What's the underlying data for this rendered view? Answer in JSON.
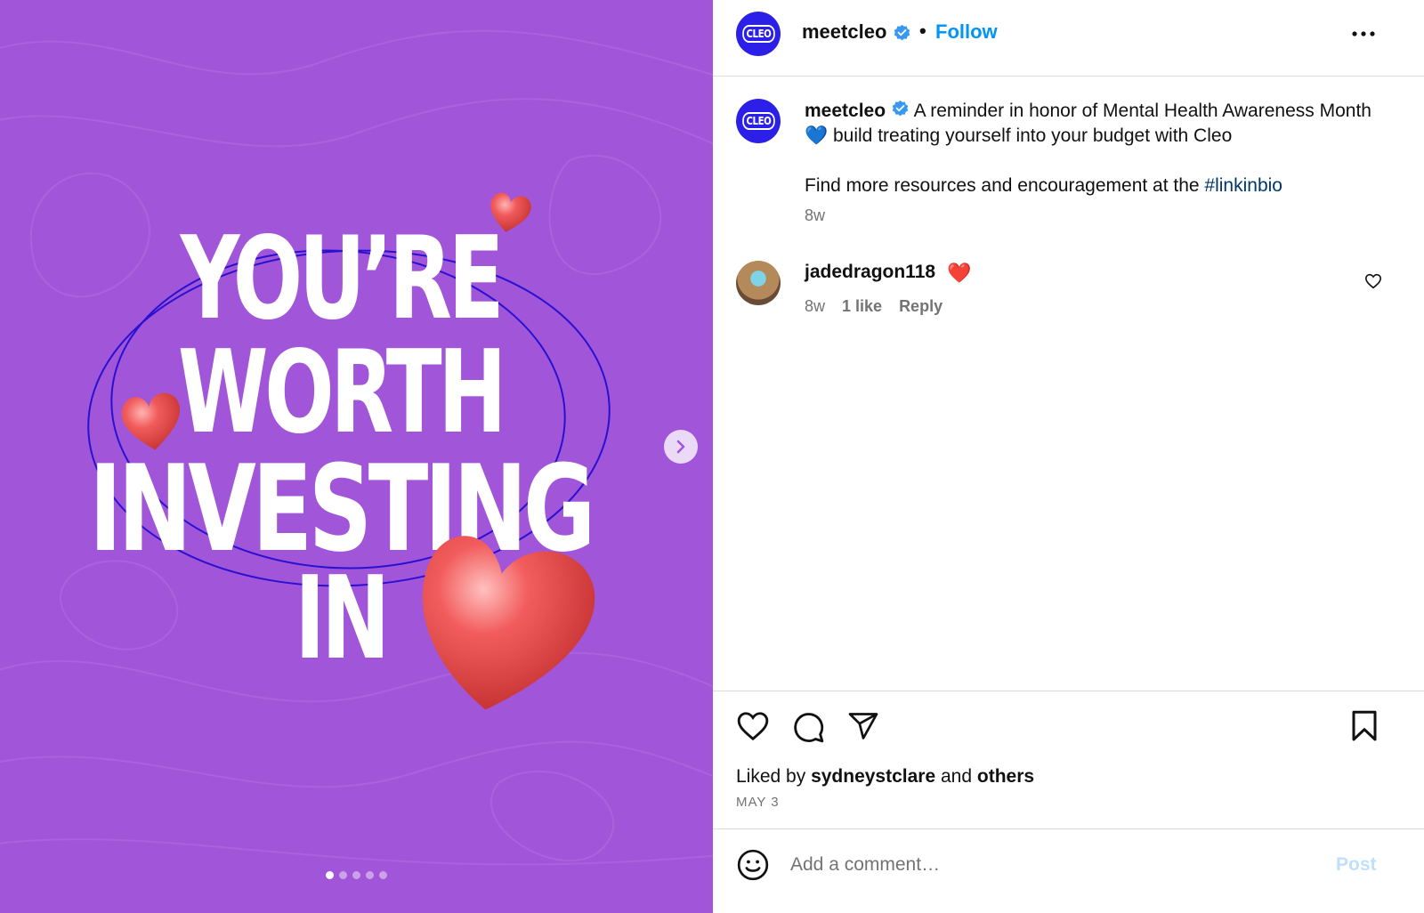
{
  "media": {
    "headline_lines": [
      "YOU’RE",
      "WORTH",
      "INVESTING",
      "IN"
    ],
    "carousel_dots": 5,
    "active_dot_index": 0,
    "background_color": "#a156d9",
    "next_icon": "chevron-right-icon"
  },
  "header": {
    "avatar_text": "CLEO",
    "username": "meetcleo",
    "separator": "•",
    "follow_label": "Follow",
    "more_icon": "more-horizontal-icon"
  },
  "caption": {
    "username": "meetcleo",
    "text_part1": " A reminder in honor of Mental Health Awareness Month ",
    "emoji": "💙",
    "text_part2": " build treating yourself into your budget with Cleo",
    "text_part3": "Find more resources and encouragement at the ",
    "hashtag": "#linkinbio",
    "time": "8w"
  },
  "comment": {
    "username": "jadedragon118",
    "emoji": "❤️",
    "time": "8w",
    "likes": "1 like",
    "reply_label": "Reply"
  },
  "actions": {
    "liked_by_prefix": "Liked by ",
    "liked_by_user": "sydneystclare",
    "liked_by_mid": " and ",
    "liked_by_others": "others",
    "date": "MAY 3"
  },
  "comment_box": {
    "placeholder": "Add a comment…",
    "post_label": "Post"
  },
  "colors": {
    "accent_blue": "#0095f6",
    "cleo_blue": "#2b1fe8",
    "hashtag": "#00376b",
    "muted": "#737373"
  }
}
